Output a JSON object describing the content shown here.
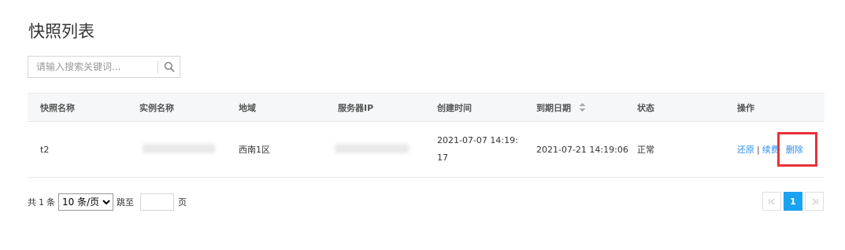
{
  "page": {
    "title": "快照列表"
  },
  "search": {
    "placeholder": "请输入搜索关键词..."
  },
  "table": {
    "headers": {
      "name": "快照名称",
      "instance": "实例名称",
      "region": "地域",
      "server_ip": "服务器IP",
      "created": "创建时间",
      "expiry": "到期日期",
      "status": "状态",
      "actions": "操作"
    },
    "rows": [
      {
        "name": "t2",
        "region": "西南1区",
        "created": "2021-07-07 14:19:17",
        "expiry": "2021-07-21 14:19:06",
        "status": "正常",
        "actions": {
          "restore": "还原",
          "renew": "续费",
          "delete": "删除",
          "separator": "|"
        }
      }
    ]
  },
  "footer": {
    "total_prefix": "共",
    "total_count": "1",
    "total_suffix": "条",
    "page_size_selected": "10 条/页",
    "jump_label": "跳至",
    "page_suffix": "页"
  },
  "pagination": {
    "prev": "|<",
    "current_page": "1",
    "next": ">|"
  },
  "colors": {
    "accent": "#2b8ff0",
    "active_page": "#1aa3f0",
    "highlight_box": "#e8323c"
  }
}
